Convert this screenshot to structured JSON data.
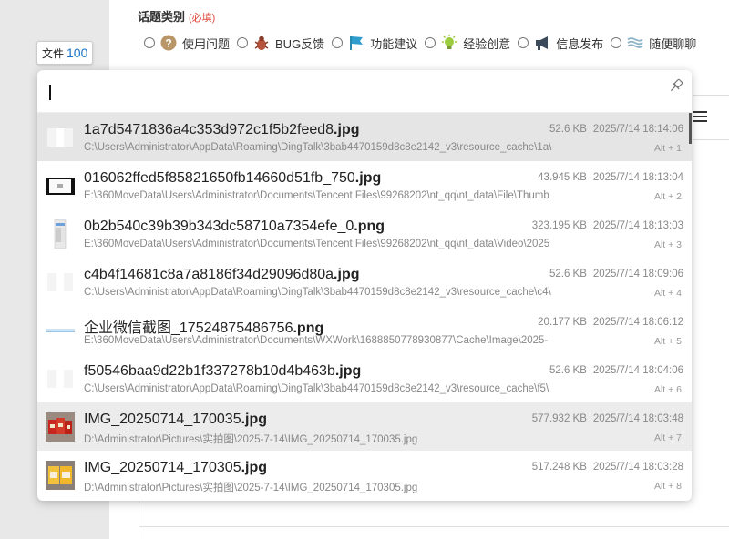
{
  "page": {
    "title": "话题类别",
    "required": "(必填)",
    "categories": [
      {
        "label": "使用问题",
        "icon": "question-circle-icon"
      },
      {
        "label": "BUG反馈",
        "icon": "bug-icon"
      },
      {
        "label": "功能建议",
        "icon": "flag-icon"
      },
      {
        "label": "经验创意",
        "icon": "lightbulb-icon"
      },
      {
        "label": "信息发布",
        "icon": "megaphone-icon"
      },
      {
        "label": "随便聊聊",
        "icon": "wave-icon"
      }
    ]
  },
  "file_tag": {
    "label": "文件",
    "count": "100"
  },
  "search": {
    "query": ""
  },
  "results": [
    {
      "name": "1a7d5471836a4c353d972c1f5b2feed8",
      "ext": ".jpg",
      "path": "C:\\Users\\Administrator\\AppData\\Roaming\\DingTalk\\3bab4470159d8c8e2142_v3\\resource_cache\\1a\\",
      "size": "52.6 KB",
      "date": "2025/7/14 18:14:06",
      "shortcut": "Alt + 1",
      "thumb": "blank"
    },
    {
      "name": "016062ffed5f85821650fb14660d51fb_750",
      "ext": ".jpg",
      "path": "E:\\360MoveData\\Users\\Administrator\\Documents\\Tencent Files\\99268202\\nt_qq\\nt_data\\File\\Thumb",
      "size": "43.945 KB",
      "date": "2025/7/14 18:13:04",
      "shortcut": "Alt + 2",
      "thumb": "dark"
    },
    {
      "name": "0b2b540c39b39b343dc58710a7354efe_0",
      "ext": ".png",
      "path": "E:\\360MoveData\\Users\\Administrator\\Documents\\Tencent Files\\99268202\\nt_qq\\nt_data\\Video\\2025",
      "size": "323.195 KB",
      "date": "2025/7/14 18:13:03",
      "shortcut": "Alt + 3",
      "thumb": "phone"
    },
    {
      "name": "c4b4f14681c8a7a8186f34d29096d80a",
      "ext": ".jpg",
      "path": "C:\\Users\\Administrator\\AppData\\Roaming\\DingTalk\\3bab4470159d8c8e2142_v3\\resource_cache\\c4\\",
      "size": "52.6 KB",
      "date": "2025/7/14 18:09:06",
      "shortcut": "Alt + 4",
      "thumb": "blank"
    },
    {
      "name": "企业微信截图_17524875486756",
      "ext": ".png",
      "path": "E:\\360MoveData\\Users\\Administrator\\Documents\\WXWork\\1688850778930877\\Cache\\Image\\2025-",
      "size": "20.177 KB",
      "date": "2025/7/14 18:06:12",
      "shortcut": "Alt + 5",
      "thumb": "line"
    },
    {
      "name": "f50546baa9d22b1f337278b10d4b463b",
      "ext": ".jpg",
      "path": "C:\\Users\\Administrator\\AppData\\Roaming\\DingTalk\\3bab4470159d8c8e2142_v3\\resource_cache\\f5\\",
      "size": "52.6 KB",
      "date": "2025/7/14 18:04:06",
      "shortcut": "Alt + 6",
      "thumb": "blank"
    },
    {
      "name": "IMG_20250714_170035",
      "ext": ".jpg",
      "path": "D:\\Administrator\\Pictures\\实拍图\\2025-7-14\\IMG_20250714_170035.jpg",
      "size": "577.932 KB",
      "date": "2025/7/14 18:03:48",
      "shortcut": "Alt + 7",
      "thumb": "red-photo"
    },
    {
      "name": "IMG_20250714_170305",
      "ext": ".jpg",
      "path": "D:\\Administrator\\Pictures\\实拍图\\2025-7-14\\IMG_20250714_170305.jpg",
      "size": "517.248 KB",
      "date": "2025/7/14 18:03:28",
      "shortcut": "Alt + 8",
      "thumb": "yellow-photo"
    }
  ],
  "colors": {
    "accent": "#1a73c9",
    "required": "#e0463a",
    "selected_row": "#e5e5e5"
  }
}
